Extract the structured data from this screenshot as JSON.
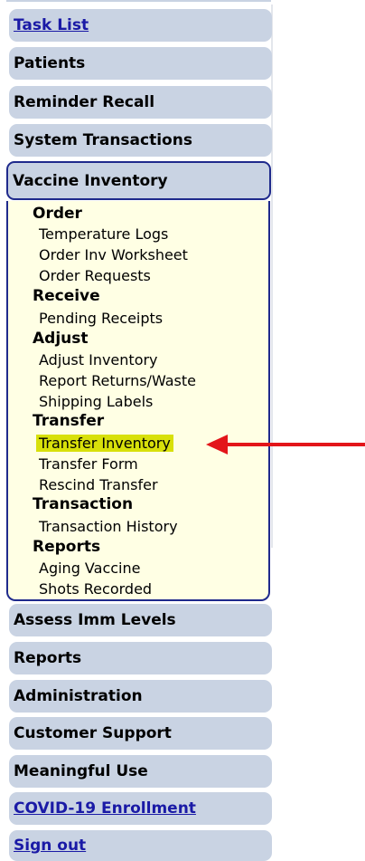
{
  "menu": {
    "task_list": "Task List",
    "patients": "Patients",
    "reminder_recall": "Reminder Recall",
    "system_transactions": "System Transactions",
    "vaccine_inventory": "Vaccine Inventory",
    "assess_imm_levels": "Assess Imm Levels",
    "reports": "Reports",
    "administration": "Administration",
    "customer_support": "Customer Support",
    "meaningful_use": "Meaningful Use",
    "covid_enrollment": "COVID-19 Enrollment",
    "sign_out": "Sign out"
  },
  "submenu": {
    "order": {
      "header": "Order",
      "items": [
        "Temperature Logs",
        "Order Inv Worksheet",
        "Order Requests"
      ]
    },
    "receive": {
      "header": "Receive",
      "items": [
        "Pending Receipts"
      ]
    },
    "adjust": {
      "header": "Adjust",
      "items": [
        "Adjust Inventory",
        "Report Returns/Waste",
        "Shipping Labels"
      ]
    },
    "transfer": {
      "header": "Transfer",
      "items": [
        "Transfer Inventory",
        "Transfer Form",
        "Rescind Transfer"
      ]
    },
    "transaction": {
      "header": "Transaction",
      "items": [
        "Transaction History"
      ]
    },
    "reports": {
      "header": "Reports",
      "items": [
        "Aging Vaccine",
        "Shots Recorded"
      ]
    }
  },
  "colors": {
    "button_bg": "#c9d3e3",
    "panel_bg": "#ffffe4",
    "panel_border": "#1f2a8c",
    "link": "#1a1aa6",
    "highlight": "#d8e00a",
    "arrow": "#e3151a"
  },
  "highlighted_item": "Transfer Inventory",
  "annotation_icon": "red-arrow-icon"
}
